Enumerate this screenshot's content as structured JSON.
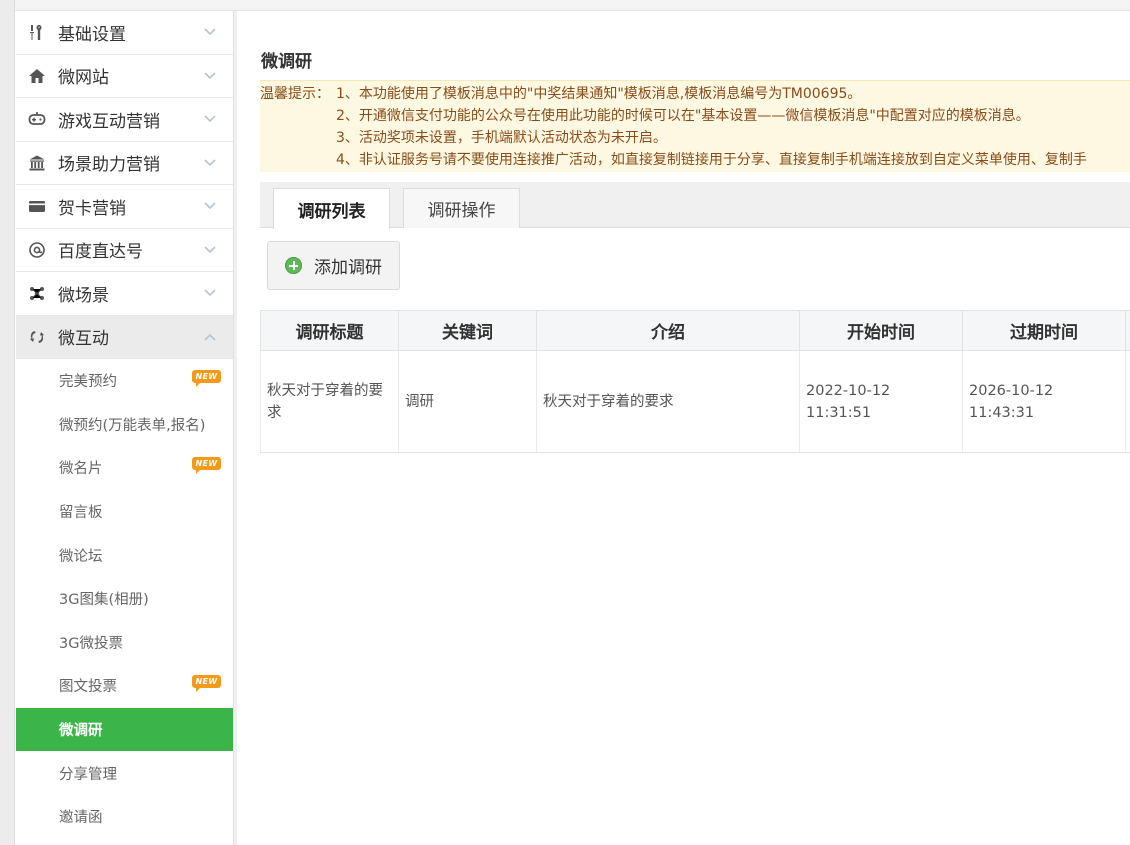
{
  "sidebar": {
    "groups": [
      {
        "label": "基础设置",
        "icon": "tools-icon",
        "expanded": false
      },
      {
        "label": "微网站",
        "icon": "home-icon",
        "expanded": false
      },
      {
        "label": "游戏互动营销",
        "icon": "gamepad-icon",
        "expanded": false
      },
      {
        "label": "场景助力营销",
        "icon": "bank-icon",
        "expanded": false
      },
      {
        "label": "贺卡营销",
        "icon": "card-icon",
        "expanded": false
      },
      {
        "label": "百度直达号",
        "icon": "at-icon",
        "expanded": false
      },
      {
        "label": "微场景",
        "icon": "molecule-icon",
        "expanded": false
      },
      {
        "label": "微互动",
        "icon": "interact-icon",
        "expanded": true
      }
    ],
    "subitems": [
      {
        "label": "完美预约",
        "badge": "NEW"
      },
      {
        "label": "微预约(万能表单,报名)",
        "badge": ""
      },
      {
        "label": "微名片",
        "badge": "NEW"
      },
      {
        "label": "留言板",
        "badge": ""
      },
      {
        "label": "微论坛",
        "badge": ""
      },
      {
        "label": "3G图集(相册)",
        "badge": ""
      },
      {
        "label": "3G微投票",
        "badge": ""
      },
      {
        "label": "图文投票",
        "badge": "NEW"
      },
      {
        "label": "微调研",
        "badge": "",
        "active": true
      },
      {
        "label": "分享管理",
        "badge": ""
      },
      {
        "label": "邀请函",
        "badge": ""
      }
    ]
  },
  "main": {
    "title": "微调研",
    "notice": {
      "lead": "温馨提示：",
      "lines": [
        "1、本功能使用了模板消息中的\"中奖结果通知\"模板消息,模板消息编号为TM00695。",
        "2、开通微信支付功能的公众号在使用此功能的时候可以在\"基本设置——微信模板消息\"中配置对应的模板消息。",
        "3、活动奖项未设置，手机端默认活动状态为未开启。",
        "4、非认证服务号请不要使用连接推广活动，如直接复制链接用于分享、直接复制手机端连接放到自定义菜单使用、复制手"
      ]
    },
    "tabs": [
      "调研列表",
      "调研操作"
    ],
    "add_button": "添加调研",
    "table": {
      "headers": [
        "调研标题",
        "关键词",
        "介绍",
        "开始时间",
        "过期时间"
      ],
      "rows": [
        [
          "秋天对于穿着的要求",
          "调研",
          "秋天对于穿着的要求",
          "2022-10-12 11:31:51",
          "2026-10-12 11:43:31"
        ]
      ]
    }
  },
  "colors": {
    "active_green": "#3bb44a",
    "badge_orange": "#f39a1a",
    "notice_bg": "#fdf8e1",
    "notice_text": "#8a4c1a"
  }
}
